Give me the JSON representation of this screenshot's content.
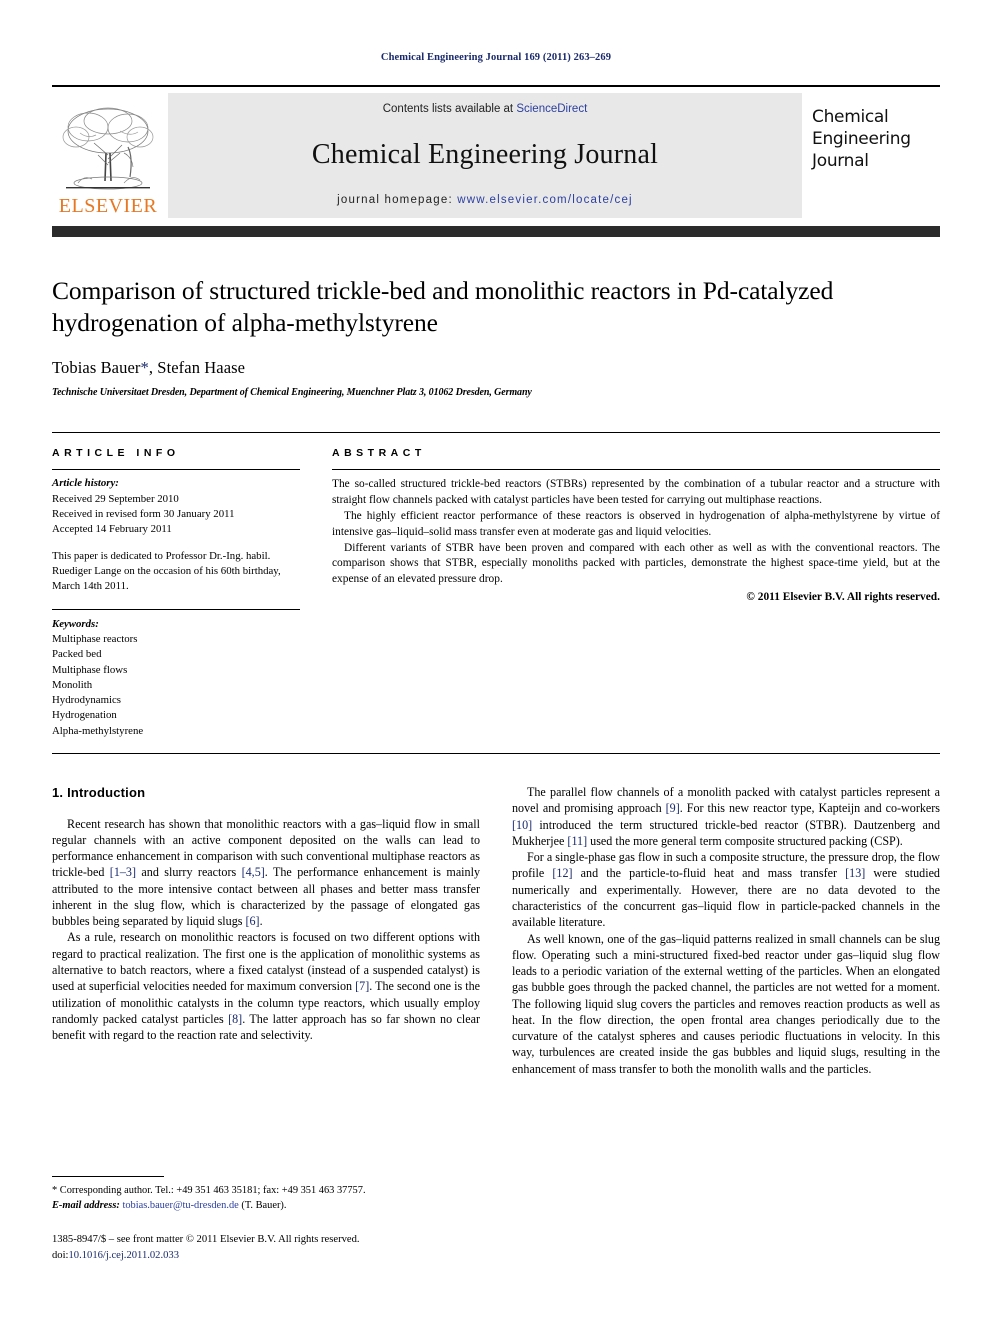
{
  "running_head": "Chemical Engineering Journal 169 (2011) 263–269",
  "masthead": {
    "contents_prefix": "Contents lists available at ",
    "sciencedirect": "ScienceDirect",
    "journal_title": "Chemical Engineering Journal",
    "homepage_prefix": "journal homepage: ",
    "homepage_url": "www.elsevier.com/locate/cej",
    "publisher_wordmark": "ELSEVIER",
    "cover_title_line1": "Chemical",
    "cover_title_line2": "Engineering",
    "cover_title_line3": "Journal",
    "link_color": "#2b3fa0",
    "band_color": "#2b2b2b",
    "panel_color": "#e8e8e8",
    "wordmark_color": "#E87722"
  },
  "title_block": {
    "title": "Comparison of structured trickle-bed and monolithic reactors in Pd-catalyzed hydrogenation of alpha-methylstyrene",
    "authors": "Tobias Bauer",
    "corresponding_marker": "*",
    "authors_rest": ", Stefan Haase",
    "affiliation": "Technische Universitaet Dresden, Department of Chemical Engineering, Muenchner Platz 3, 01062 Dresden, Germany"
  },
  "article_info": {
    "heading": "ARTICLE INFO",
    "history_label": "Article history:",
    "received": "Received 29 September 2010",
    "revised": "Received in revised form 30 January 2011",
    "accepted": "Accepted 14 February 2011",
    "dedication": "This paper is dedicated to Professor Dr.-Ing. habil. Ruediger Lange on the occasion of his 60th birthday, March 14th 2011.",
    "keywords_label": "Keywords:",
    "keywords": [
      "Multiphase reactors",
      "Packed bed",
      "Multiphase flows",
      "Monolith",
      "Hydrodynamics",
      "Hydrogenation",
      "Alpha-methylstyrene"
    ]
  },
  "abstract": {
    "heading": "ABSTRACT",
    "paragraphs": [
      "The so-called structured trickle-bed reactors (STBRs) represented by the combination of a tubular reactor and a structure with straight flow channels packed with catalyst particles have been tested for carrying out multiphase reactions.",
      "The highly efficient reactor performance of these reactors is observed in hydrogenation of alpha-methylstyrene by virtue of intensive gas–liquid–solid mass transfer even at moderate gas and liquid velocities.",
      "Different variants of STBR have been proven and compared with each other as well as with the conventional reactors. The comparison shows that STBR, especially monoliths packed with particles, demonstrate the highest space-time yield, but at the expense of an elevated pressure drop."
    ],
    "copyright": "© 2011 Elsevier B.V. All rights reserved."
  },
  "introduction": {
    "section_number": "1.",
    "section_title": "Introduction",
    "left_paragraphs": [
      {
        "segments": [
          {
            "t": "Recent research has shown that monolithic reactors with a gas–liquid flow in small regular channels with an active component deposited on the walls can lead to performance enhancement in comparison with such conventional multiphase reactors as trickle-bed "
          },
          {
            "t": "[1–3]",
            "ref": true
          },
          {
            "t": " and slurry reactors "
          },
          {
            "t": "[4,5]",
            "ref": true
          },
          {
            "t": ". The performance enhancement is mainly attributed to the more intensive contact between all phases and better mass transfer inherent in the slug flow, which is characterized by the passage of elongated gas bubbles being separated by liquid slugs "
          },
          {
            "t": "[6]",
            "ref": true
          },
          {
            "t": "."
          }
        ]
      },
      {
        "segments": [
          {
            "t": "As a rule, research on monolithic reactors is focused on two different options with regard to practical realization. The first one is the application of monolithic systems as alternative to batch reactors, where a fixed catalyst (instead of a suspended catalyst) is used at superficial velocities needed for maximum conversion "
          },
          {
            "t": "[7]",
            "ref": true
          },
          {
            "t": ". The second one is the utilization of monolithic catalysts in the column type reactors, which usually employ randomly packed catalyst particles "
          },
          {
            "t": "[8]",
            "ref": true
          },
          {
            "t": ". The latter approach has so far shown no clear benefit with regard to the reaction rate and selectivity."
          }
        ]
      }
    ],
    "right_paragraphs": [
      {
        "segments": [
          {
            "t": "The parallel flow channels of a monolith packed with catalyst particles represent a novel and promising approach "
          },
          {
            "t": "[9]",
            "ref": true
          },
          {
            "t": ". For this new reactor type, Kapteijn and co-workers "
          },
          {
            "t": "[10]",
            "ref": true
          },
          {
            "t": " introduced the term structured trickle-bed reactor (STBR). Dautzenberg and Mukherjee "
          },
          {
            "t": "[11]",
            "ref": true
          },
          {
            "t": " used the more general term composite structured packing (CSP)."
          }
        ]
      },
      {
        "segments": [
          {
            "t": "For a single-phase gas flow in such a composite structure, the pressure drop, the flow profile "
          },
          {
            "t": "[12]",
            "ref": true
          },
          {
            "t": " and the particle-to-fluid heat and mass transfer "
          },
          {
            "t": "[13]",
            "ref": true
          },
          {
            "t": " were studied numerically and experimentally. However, there are no data devoted to the characteristics of the concurrent gas–liquid flow in particle-packed channels in the available literature."
          }
        ]
      },
      {
        "segments": [
          {
            "t": "As well known, one of the gas–liquid patterns realized in small channels can be slug flow. Operating such a mini-structured fixed-bed reactor under gas–liquid slug flow leads to a periodic variation of the external wetting of the particles. When an elongated gas bubble goes through the packed channel, the particles are not wetted for a moment. The following liquid slug covers the particles and removes reaction products as well as heat. In the flow direction, the open frontal area changes periodically due to the curvature of the catalyst spheres and causes periodic fluctuations in velocity. In this way, turbulences are created inside the gas bubbles and liquid slugs, resulting in the enhancement of mass transfer to both the monolith walls and the particles."
          }
        ]
      }
    ]
  },
  "footnotes": {
    "corresponding": "* Corresponding author. Tel.: +49 351 463 35181; fax: +49 351 463 37757.",
    "email_label": "E-mail address:",
    "email": "tobias.bauer@tu-dresden.de",
    "email_suffix": "(T. Bauer).",
    "issn_line": "1385-8947/$ – see front matter © 2011 Elsevier B.V. All rights reserved.",
    "doi_label": "doi:",
    "doi": "10.1016/j.cej.2011.02.033"
  }
}
